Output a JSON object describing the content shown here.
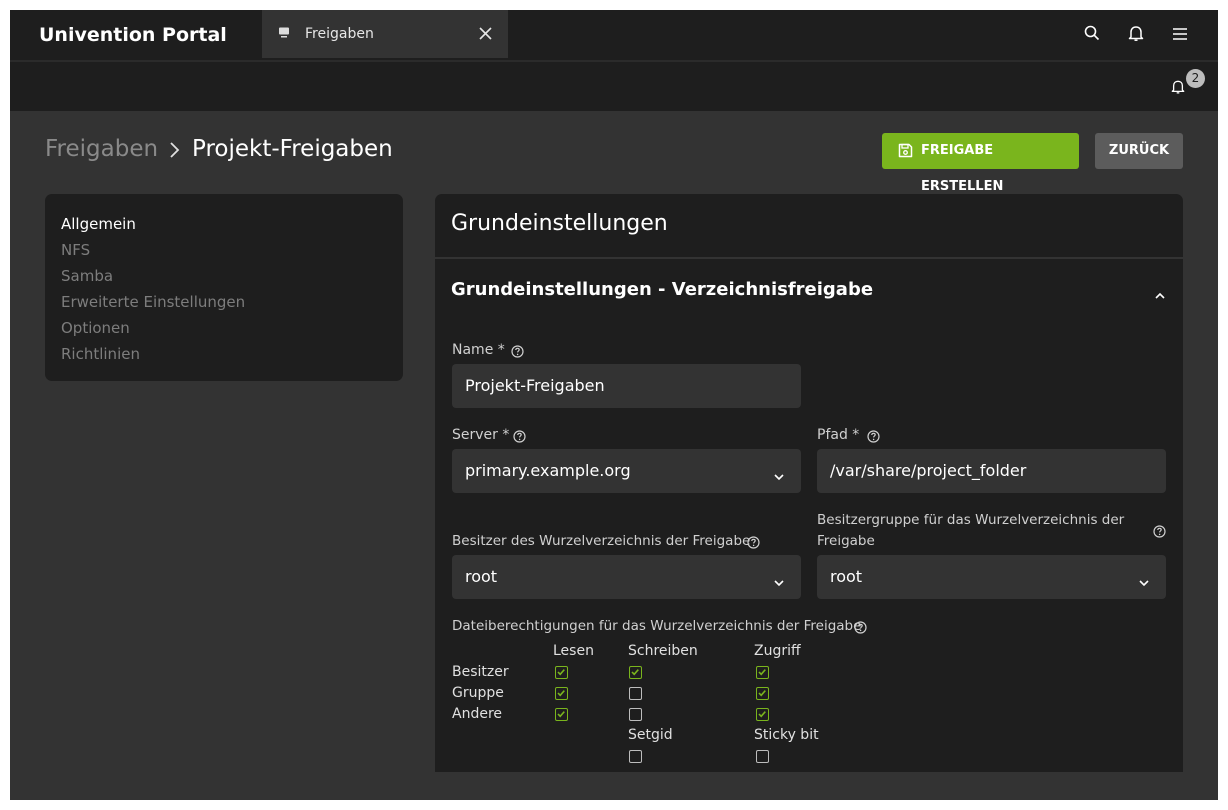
{
  "header": {
    "brand": "Univention Portal",
    "tab": {
      "label": "Freigaben",
      "icon": "share-icon"
    },
    "icons": [
      "search-icon",
      "bell-icon",
      "menu-icon"
    ]
  },
  "notifications": {
    "count": "2"
  },
  "breadcrumb": {
    "parent": "Freigaben",
    "current": "Projekt-Freigaben"
  },
  "actions": {
    "create_label": "FREIGABE ERSTELLEN",
    "back_label": "ZURÜCK"
  },
  "sidenav": {
    "items": [
      {
        "label": "Allgemein",
        "active": true
      },
      {
        "label": "NFS"
      },
      {
        "label": "Samba"
      },
      {
        "label": "Erweiterte Einstellungen"
      },
      {
        "label": "Optionen"
      },
      {
        "label": "Richtlinien"
      }
    ]
  },
  "panel": {
    "title": "Grundeinstellungen",
    "section_title": "Grundeinstellungen - Verzeichnisfreigabe",
    "fields": {
      "name": {
        "label": "Name *",
        "value": "Projekt-Freigaben"
      },
      "server": {
        "label": "Server *",
        "value": "primary.example.org"
      },
      "path": {
        "label": "Pfad *",
        "value": "/var/share/project_folder"
      },
      "owner": {
        "label": "Besitzer des Wurzelverzeichnis der Freigabe",
        "value": "root"
      },
      "group": {
        "label_line1": "Besitzergruppe für das Wurzelverzeichnis der",
        "label_line2": "Freigabe",
        "value": "root"
      }
    },
    "permissions": {
      "label": "Dateiberechtigungen für das Wurzelverzeichnis der Freigabe",
      "columns": [
        "Lesen",
        "Schreiben",
        "Zugriff"
      ],
      "rows": [
        {
          "label": "Besitzer",
          "read": true,
          "write": true,
          "access": true
        },
        {
          "label": "Gruppe",
          "read": true,
          "write": false,
          "access": true
        },
        {
          "label": "Andere",
          "read": true,
          "write": false,
          "access": true
        }
      ],
      "setgid": {
        "label": "Setgid",
        "checked": false
      },
      "sticky": {
        "label": "Sticky bit",
        "checked": false
      }
    }
  },
  "colors": {
    "accent": "#7ab51d",
    "bg": "#333333",
    "surface": "#1e1e1e"
  }
}
